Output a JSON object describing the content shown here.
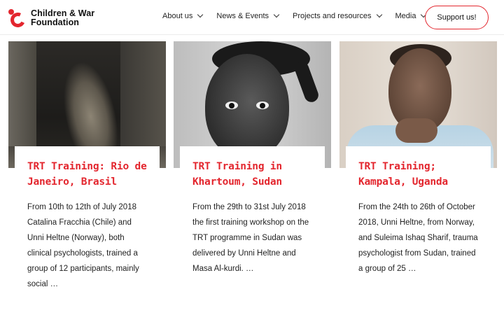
{
  "header": {
    "logo_line1": "Children & War",
    "logo_line2": "Foundation",
    "nav": [
      {
        "label": "About us"
      },
      {
        "label": "News & Events"
      },
      {
        "label": "Projects and resources"
      },
      {
        "label": "Media"
      }
    ],
    "support_label": "Support us!"
  },
  "cards": [
    {
      "title": "TRT Training: Rio de Janeiro, Brasil",
      "excerpt": "From 10th to 12th of July 2018 Catalina Fracchia (Chile) and Unni Heltne (Norway), both clinical psychologists, trained a group of 12 participants, mainly social …"
    },
    {
      "title": "TRT Training in Khartoum, Sudan",
      "excerpt": "From the 29th to 31st July 2018 the first training workshop on the TRT programme in Sudan was delivered by Unni Heltne and Masa Al-kurdi. …"
    },
    {
      "title": "TRT Training; Kampala, Uganda",
      "excerpt": "From the 24th to 26th of October 2018, Unni Heltne, from Norway, and Suleima Ishaq Sharif, trauma psychologist from Sudan, trained a group of 25 …"
    }
  ],
  "colors": {
    "brand_red": "#e3262e",
    "text": "#222222"
  },
  "icons": {
    "logo": "children-and-war-logo-icon",
    "nav_chevron": "chevron-down-icon"
  }
}
